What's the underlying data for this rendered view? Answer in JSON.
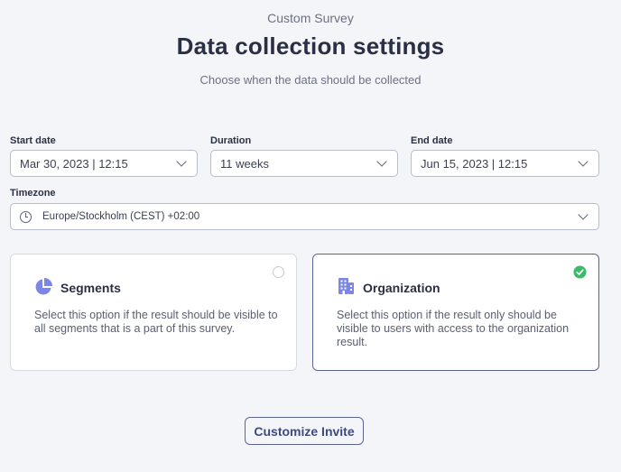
{
  "header": {
    "context": "Custom Survey",
    "title": "Data collection settings",
    "description": "Choose when the data should be collected"
  },
  "form": {
    "start_date": {
      "label": "Start date",
      "value": "Mar 30, 2023 | 12:15"
    },
    "duration": {
      "label": "Duration",
      "value": "11 weeks"
    },
    "end_date": {
      "label": "End date",
      "value": "Jun 15, 2023 | 12:15"
    },
    "timezone": {
      "label": "Timezone",
      "value": "Europe/Stockholm (CEST) +02:00"
    }
  },
  "options": {
    "segments": {
      "title": "Segments",
      "description": "Select this option if the result should be visible to all segments that is a part of this survey.",
      "selected": false,
      "icon": "pie-chart-icon"
    },
    "organization": {
      "title": "Organization",
      "description": "Select this option if the result only should be visible to users with access to the organization result.",
      "selected": true,
      "icon": "building-icon"
    }
  },
  "actions": {
    "customize_invite": "Customize Invite"
  },
  "colors": {
    "accent": "#5c6590",
    "icon": "#7b86e8",
    "check": "#3dba6a",
    "background": "#f4f5f9"
  }
}
